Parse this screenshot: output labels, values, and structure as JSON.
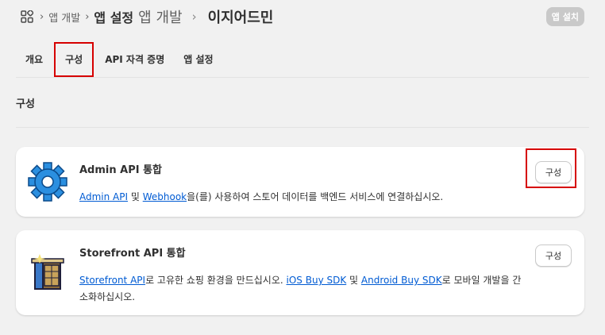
{
  "breadcrumb": {
    "apps_link": "앱 개발",
    "settings": "앱 설정",
    "dev": "앱 개발",
    "app_name": "이지어드민"
  },
  "install_badge": "앱 설치",
  "tabs": [
    {
      "label": "개요",
      "active": false
    },
    {
      "label": "구성",
      "active": true
    },
    {
      "label": "API 자격 증명",
      "active": false
    },
    {
      "label": "앱 설정",
      "active": false
    }
  ],
  "section_title": "구성",
  "cards": [
    {
      "icon": "gear-icon",
      "title": "Admin API 통합",
      "link1": "Admin API",
      "mid1": " 및 ",
      "link2": "Webhook",
      "tail": "을(를) 사용하여 스토어 데이터를 백엔드 서비스에 연결하십시오.",
      "button": "구성"
    },
    {
      "icon": "storefront-icon",
      "title": "Storefront API 통합",
      "link1": "Storefront API",
      "mid1": "로 고유한 쇼핑 환경을 만드십시오. ",
      "link2": "iOS Buy SDK",
      "mid2": " 및 ",
      "link3": "Android Buy SDK",
      "tail": "로 모바일 개발을 간소화하십시오.",
      "button": "구성"
    }
  ]
}
